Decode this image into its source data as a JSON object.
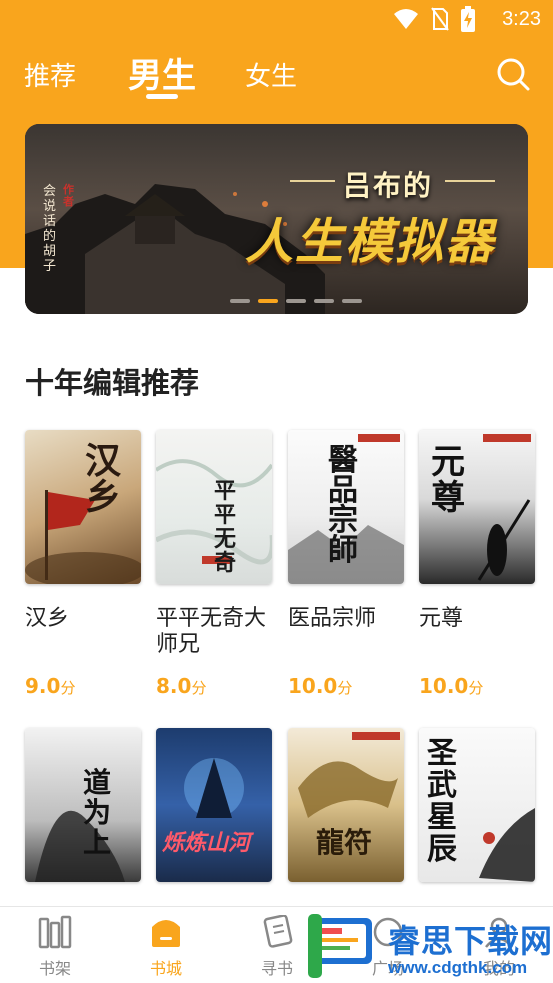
{
  "status_bar": {
    "time": "3:23"
  },
  "top_tabs": [
    {
      "label": "推荐"
    },
    {
      "label": "男生"
    },
    {
      "label": "女生"
    }
  ],
  "banner": {
    "title_line1": "吕布的",
    "title_line2": "人生模拟器",
    "author": "会说话的胡子",
    "seal": "作者",
    "slide_count": 5,
    "active_slide": 2
  },
  "section": {
    "title": "十年编辑推荐"
  },
  "books": [
    {
      "title": "汉乡",
      "score": "9.0",
      "unit": "分",
      "cover_text": "汉乡"
    },
    {
      "title": "平平无奇大师兄",
      "score": "8.0",
      "unit": "分",
      "cover_text": "平平无奇"
    },
    {
      "title": "医品宗师",
      "score": "10.0",
      "unit": "分",
      "cover_text": "醫品宗師"
    },
    {
      "title": "元尊",
      "score": "10.0",
      "unit": "分",
      "cover_text": "元尊"
    }
  ],
  "books_row2": [
    {
      "cover_text": "道为上"
    },
    {
      "cover_text": "烁炼山河"
    },
    {
      "cover_text": "龍符"
    },
    {
      "cover_text": "圣武星辰"
    }
  ],
  "bottom_nav": [
    {
      "label": "书架",
      "icon": "bookshelf-icon"
    },
    {
      "label": "书城",
      "icon": "bookstore-icon"
    },
    {
      "label": "寻书",
      "icon": "find-book-icon"
    },
    {
      "label": "广场",
      "icon": "plaza-icon"
    },
    {
      "label": "我的",
      "icon": "profile-icon"
    }
  ],
  "watermark": {
    "name": "睿思下载网",
    "url": "www.cdgthk.com"
  },
  "colors": {
    "accent": "#f9a51d",
    "text": "#222222",
    "inactive": "#888888"
  }
}
